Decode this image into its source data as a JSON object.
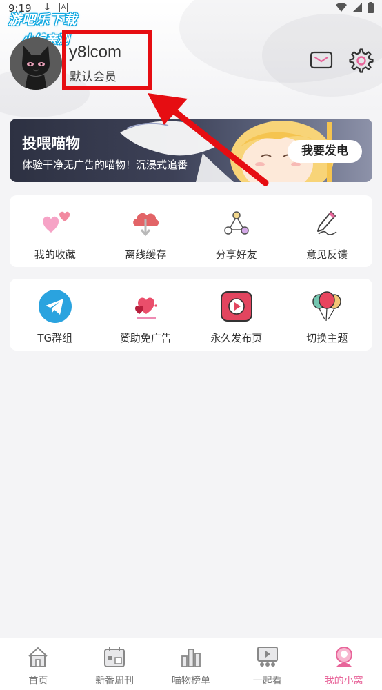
{
  "status_bar": {
    "time": "9:19",
    "a_badge": "A"
  },
  "watermark": {
    "line1": "游吧乐下载",
    "line2": "小编亲测"
  },
  "profile": {
    "username": "y8lcom",
    "membership": "默认会员"
  },
  "banner": {
    "title": "投喂喵物",
    "subtitle": "体验干净无广告的喵物！沉浸式追番",
    "button_label": "我要发电"
  },
  "features": [
    {
      "label": "我的收藏",
      "icon": "hearts-icon"
    },
    {
      "label": "离线缓存",
      "icon": "cloud-download-icon"
    },
    {
      "label": "分享好友",
      "icon": "share-nodes-icon"
    },
    {
      "label": "意见反馈",
      "icon": "pen-feedback-icon"
    }
  ],
  "extras": [
    {
      "label": "TG群组",
      "icon": "telegram-icon"
    },
    {
      "label": "赞助免广告",
      "icon": "heart-sponsor-icon"
    },
    {
      "label": "永久发布页",
      "icon": "play-button-icon"
    },
    {
      "label": "切换主题",
      "icon": "balloons-icon"
    }
  ],
  "tabs": [
    {
      "label": "首页",
      "icon": "home-icon"
    },
    {
      "label": "新番周刊",
      "icon": "calendar-icon"
    },
    {
      "label": "喵物榜单",
      "icon": "bar-chart-icon"
    },
    {
      "label": "一起看",
      "icon": "watch-together-icon"
    },
    {
      "label": "我的小窝",
      "icon": "profile-icon",
      "active": true
    }
  ],
  "colors": {
    "accent": "#e8659a",
    "annotation": "#e60d12",
    "banner_dark": "#2d3142",
    "telegram": "#2aa3df"
  }
}
